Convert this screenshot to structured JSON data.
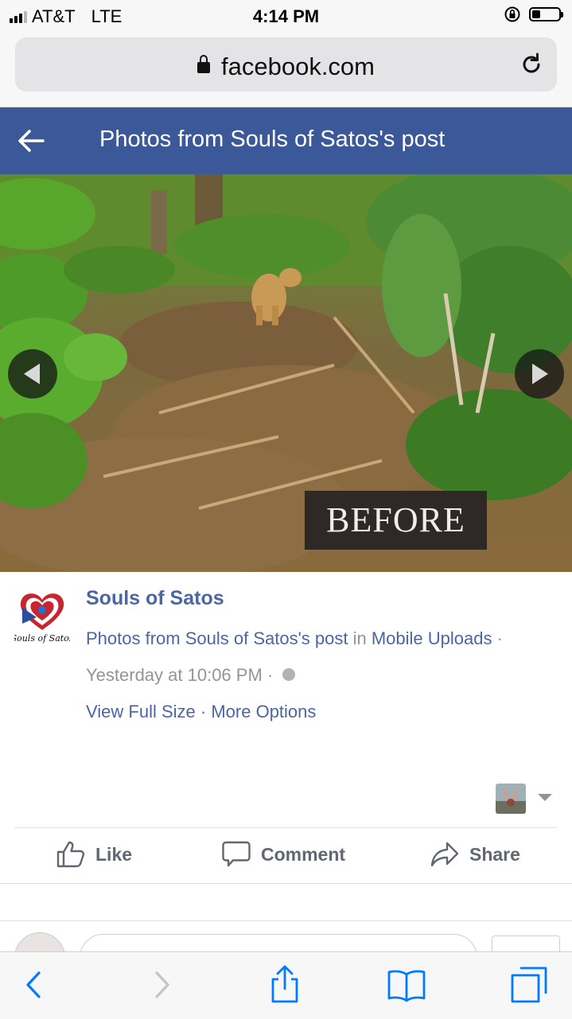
{
  "status_bar": {
    "carrier": "AT&T",
    "network": "LTE",
    "time": "4:14 PM",
    "battery_level": 0.3,
    "icons": [
      "signal-icon",
      "rotation-lock-icon",
      "battery-icon"
    ]
  },
  "browser": {
    "url": "facebook.com",
    "icons": [
      "lock-icon",
      "reload-icon"
    ]
  },
  "header": {
    "title": "Photos from Souls of Satos's post",
    "back_icon": "back-arrow-icon",
    "background": "#3b5998"
  },
  "photo": {
    "overlay_text": "BEFORE",
    "nav_icons": [
      "prev-photo-icon",
      "next-photo-icon"
    ]
  },
  "post": {
    "page_name": "Souls of Satos",
    "source_prefix": "Photos from Souls of Satos's post",
    "source_in": "in",
    "album": "Mobile Uploads",
    "separator": "·",
    "timestamp": "Yesterday at 10:06 PM",
    "view_full_size": "View Full Size",
    "more_options": "More Options",
    "link_color": "#4b67a1"
  },
  "actions": {
    "like": "Like",
    "comment": "Comment",
    "share": "Share"
  },
  "toolbar": {
    "icons": [
      "back-icon",
      "forward-icon",
      "share-icon",
      "bookmarks-icon",
      "tabs-icon"
    ],
    "accent": "#007aff"
  }
}
